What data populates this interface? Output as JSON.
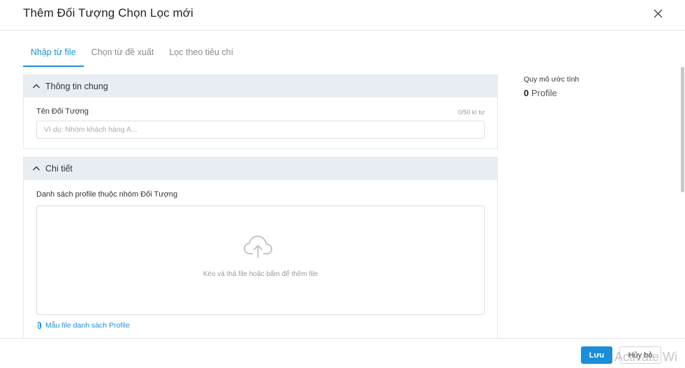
{
  "dialog": {
    "title": "Thêm Đối Tượng Chọn Lọc mới",
    "close_icon": "close-icon"
  },
  "tabs": [
    {
      "label": "Nhập từ file",
      "active": true
    },
    {
      "label": "Chọn từ đề xuất",
      "active": false
    },
    {
      "label": "Lọc theo tiêu chí",
      "active": false
    }
  ],
  "general": {
    "header": "Thông tin chung",
    "name_label": "Tên Đối Tượng",
    "counter": "0/50 kí tự",
    "name_placeholder": "Ví dụ: Nhóm khách hàng A...",
    "name_value": ""
  },
  "detail": {
    "header": "Chi tiết",
    "list_label": "Danh sách profile thuộc nhóm Đối Tượng",
    "upload_hint": "Kéo và thả file hoặc bấm để thêm file",
    "upload_icon": "cloud-upload-icon",
    "sample_link": "Mẫu file danh sách Profile",
    "sample_icon": "paperclip-icon"
  },
  "estimate": {
    "label": "Quy mô ước tính",
    "count": "0",
    "unit": "Profile"
  },
  "footer": {
    "save_label": "Lưu",
    "cancel_label": "Hủy bỏ",
    "watermark": "Activate Wi"
  },
  "colors": {
    "accent": "#1a8fd8",
    "panel_header_bg": "#e8edf3"
  }
}
